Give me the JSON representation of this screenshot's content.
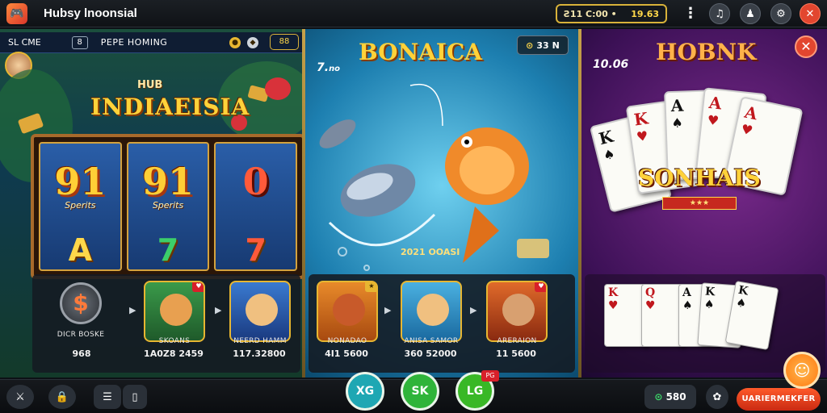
{
  "app": {
    "title": "Hubsy lnoonsial"
  },
  "topbar": {
    "balance_label": "Ƨ11 C:00 •",
    "balance_value": "19.63",
    "menu_icon": "kebab-icon",
    "buttons": [
      "music-icon",
      "user-icon",
      "settings-icon",
      "close-icon"
    ]
  },
  "panel_left": {
    "header_label": "SL CME",
    "header_badge": "8",
    "header_title": "PEPE HOMING",
    "header_count": "88",
    "hub_small": "HUB",
    "hub_big": "INDIAEISIA",
    "reels": [
      {
        "symbol": "91",
        "sub": "Sperits",
        "bottom": "A"
      },
      {
        "symbol": "91",
        "sub": "Sperits",
        "bottom": "7"
      },
      {
        "symbol": "0",
        "sub": "",
        "bottom": "7"
      }
    ],
    "tiles": [
      {
        "label": "DICR BOSKE",
        "value": "968"
      },
      {
        "label": "SKOANS",
        "value": "1A0Z8 2459"
      },
      {
        "label": "NEERD HAMM",
        "value": "117.32800"
      }
    ]
  },
  "panel_center": {
    "time": "7.",
    "time_suffix": "no",
    "title": "BONAICA",
    "counter_value": "33",
    "counter_suffix": "Ν",
    "footer": "2021 OOASI",
    "tiles": [
      {
        "label": "NONADAO",
        "value": "4I1 5600"
      },
      {
        "label": "ANISA SAMOR",
        "value": "360 52000"
      },
      {
        "label": "ARERAION",
        "value": "11 5600"
      }
    ]
  },
  "panel_right": {
    "time": "10.06",
    "title": "HOBNK",
    "banner": "SONHAIS",
    "plate": "★★★",
    "cards": [
      "K",
      "K",
      "A",
      "A",
      "A"
    ],
    "mini_cards": [
      "K",
      "Q",
      "A",
      "K",
      "K"
    ]
  },
  "bottombar": {
    "left_icons": [
      "sword-icon",
      "lock-icon",
      "list-icon",
      "cards-icon"
    ],
    "circle_buttons": [
      {
        "label": "XG",
        "color": "#1ea7b3"
      },
      {
        "label": "SK",
        "color": "#2fb43a"
      },
      {
        "label": "LG",
        "color": "#39b826",
        "badge": "PG"
      }
    ],
    "coins_value": "580",
    "cta_label": "UARIERMEKFER"
  },
  "colors": {
    "accent": "#e7b631",
    "cta": "#e2462f",
    "teal": "#1ea7b3"
  }
}
